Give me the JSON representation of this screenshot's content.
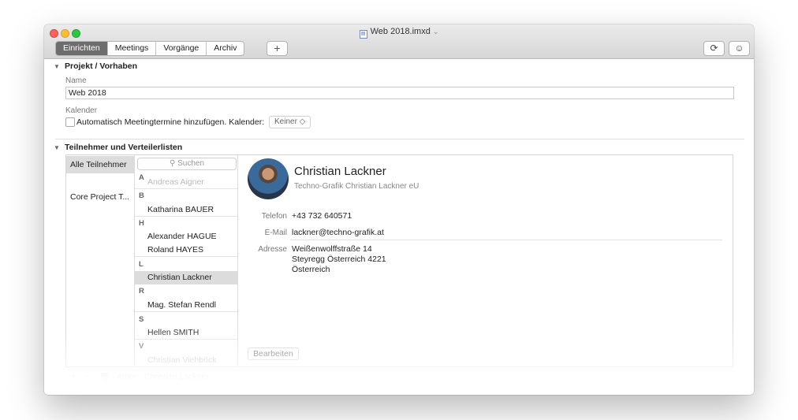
{
  "window": {
    "title": "Web 2018.imxd",
    "title_chevron": "⌄",
    "doc_icon": "▤"
  },
  "toolbar": {
    "tabs": [
      {
        "label": "Einrichten",
        "active": true
      },
      {
        "label": "Meetings",
        "active": false
      },
      {
        "label": "Vorgänge",
        "active": false
      },
      {
        "label": "Archiv",
        "active": false
      }
    ],
    "add_label": "+",
    "sync_icon": "⟳",
    "smiley_icon": "☺"
  },
  "project": {
    "section_title": "Projekt / Vorhaben",
    "name_label": "Name",
    "name_value": "Web 2018",
    "calendar_label": "Kalender",
    "checkbox_label": "Automatisch Meetingtermine hinzufügen. Kalender:",
    "checkbox_checked": false,
    "calendar_select": "Keiner ◇"
  },
  "participants": {
    "section_title": "Teilnehmer und Verteilerlisten",
    "sidebar": [
      {
        "label": "Alle Teilnehmer",
        "selected": true
      },
      {
        "label": "Core Project T...",
        "selected": false
      }
    ],
    "search_placeholder": "Suchen",
    "search_icon": "⚲",
    "letters": [
      "A",
      "B",
      "H",
      "L",
      "R",
      "S",
      "V"
    ],
    "contacts": [
      "Andreas Aigner",
      "Katharina BAUER",
      "Alexander HAGUE",
      "Roland HAYES",
      "Christian Lackner",
      "Mag. Stefan Rendl",
      "Hellen SMITH",
      "Christian Viehböck"
    ]
  },
  "detail": {
    "name": "Christian Lackner",
    "company": "Techno-Grafik Christian Lackner eU",
    "phone_label": "Telefon",
    "phone": "+43 732 640571",
    "email_label": "E-Mail",
    "email": "lackner@techno-grafik.at",
    "address_label": "Adresse",
    "address_line1": "Weißenwolffstraße 14",
    "address_line2": "Steyregg Österreich 4221",
    "address_line3": "Österreich",
    "edit_label": "Bearbeiten"
  },
  "footer": {
    "add": "+",
    "remove": "−",
    "trash_icon": "🗑",
    "author_label": "Autor:",
    "author_value": "Christian Lackner"
  }
}
